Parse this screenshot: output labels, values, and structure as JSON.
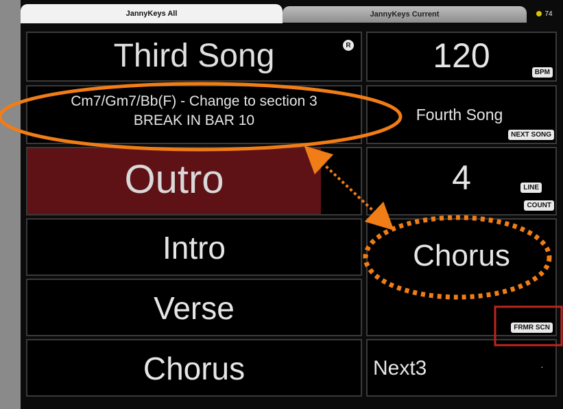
{
  "tabs": {
    "active_label": "JannyKeys All",
    "inactive_label": "JannyKeys Current",
    "status_text": "74"
  },
  "song": {
    "title": "Third Song",
    "recording_badge": "R",
    "tempo": "120",
    "tempo_unit": "BPM",
    "notes_line1": "Cm7/Gm7/Bb(F) - Change to section 3",
    "notes_line2": "BREAK IN BAR 10",
    "next_song": "Fourth Song",
    "next_song_badge": "NEXT SONG",
    "current_section": "Outro",
    "line_count": "4",
    "line_badge": "LINE",
    "count_badge": "COUNT"
  },
  "sections": [
    {
      "label": "Intro"
    },
    {
      "label": "Verse"
    },
    {
      "label": "Chorus"
    }
  ],
  "next_section": "Chorus",
  "former_scene_badge": "FRMR SCN",
  "next3": "Next3",
  "next3_dot": "·",
  "colors": {
    "accent_orange": "#f07d16",
    "current_section_bg": "#5e1216",
    "highlight_red": "#c0231e"
  }
}
